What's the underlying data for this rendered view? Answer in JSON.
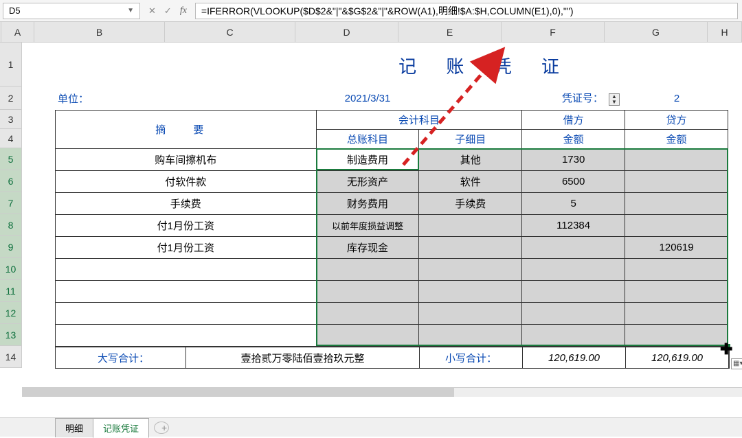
{
  "nameBox": "D5",
  "formula": "=IFERROR(VLOOKUP($D$2&\"|\"&$G$2&\"|\"&ROW(A1),明细!$A:$H,COLUMN(E1),0),\"\")",
  "columns": [
    "A",
    "B",
    "C",
    "D",
    "E",
    "F",
    "G",
    "H"
  ],
  "rows": [
    "1",
    "2",
    "3",
    "4",
    "5",
    "6",
    "7",
    "8",
    "9",
    "10",
    "11",
    "12",
    "13",
    "14"
  ],
  "title": "记 账 凭 证",
  "info": {
    "unitLabel": "单位：",
    "date": "2021/3/31",
    "voucherLabel": "凭证号：",
    "voucherNo": "2"
  },
  "headers": {
    "summary": "摘    要",
    "subject": "会计科目",
    "ledger": "总账科目",
    "sub": "子细目",
    "debit": "借方",
    "credit": "贷方",
    "amount": "金额"
  },
  "dataRows": [
    {
      "summary": "购车间擦机布",
      "ledger": "制造费用",
      "sub": "其他",
      "debit": "1730",
      "credit": ""
    },
    {
      "summary": "付软件款",
      "ledger": "无形资产",
      "sub": "软件",
      "debit": "6500",
      "credit": ""
    },
    {
      "summary": "手续费",
      "ledger": "财务费用",
      "sub": "手续费",
      "debit": "5",
      "credit": ""
    },
    {
      "summary": "付1月份工资",
      "ledger": "以前年度损益调整",
      "sub": "",
      "debit": "112384",
      "credit": ""
    },
    {
      "summary": "付1月份工资",
      "ledger": "库存现金",
      "sub": "",
      "debit": "",
      "credit": "120619"
    },
    {
      "summary": "",
      "ledger": "",
      "sub": "",
      "debit": "",
      "credit": ""
    },
    {
      "summary": "",
      "ledger": "",
      "sub": "",
      "debit": "",
      "credit": ""
    },
    {
      "summary": "",
      "ledger": "",
      "sub": "",
      "debit": "",
      "credit": ""
    },
    {
      "summary": "",
      "ledger": "",
      "sub": "",
      "debit": "",
      "credit": ""
    }
  ],
  "totals": {
    "label1": "大写合计：",
    "cn": "壹拾贰万零陆佰壹拾玖元整",
    "label2": "小写合计：",
    "debit": "120,619.00",
    "credit": "120,619.00"
  },
  "tabs": {
    "t1": "明细",
    "t2": "记账凭证"
  },
  "fx": "fx"
}
